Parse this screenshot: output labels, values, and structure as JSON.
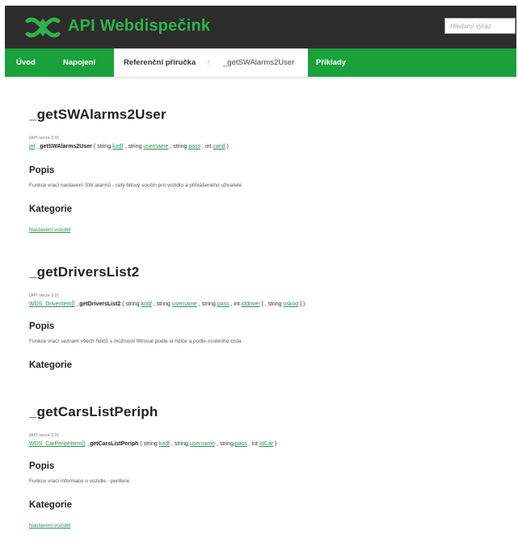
{
  "header": {
    "brand": "API Webdispečink",
    "search_placeholder": "Hledaný výraz",
    "colors": {
      "topbar": "#2c2c2c",
      "nav": "#1aa13c",
      "brand": "#2db34a",
      "link": "#2e8b57"
    }
  },
  "nav": {
    "uvod": "Úvod",
    "napojeni": "Napojení",
    "referencni": "Referenční příručka",
    "separator": "/",
    "current": "_getSWAlarms2User",
    "priklady": "Příklady"
  },
  "sections": [
    {
      "title": "_getSWAlarms2User",
      "api": "(API verze 2.0)",
      "return_type": "int",
      "fn": "_getSWAlarms2User",
      "p1_type": "string",
      "p1": "kodf",
      "p2_type": "string",
      "p2": "username",
      "p3_type": "string",
      "p3": "pass",
      "p4_type": "int",
      "p4": "carid",
      "popis_heading": "Popis",
      "popis": "Funkce vrací nastavení SW alarmů - celý bitový součin pro vozidlo a přihlášeného uživatele",
      "kategorie_heading": "Kategorie",
      "kategorie": "Nastavení vozidel"
    },
    {
      "title": "_getDriversList2",
      "api": "(API verze 2.0)",
      "return_type": "WDS_DriverItem[]",
      "fn": "_getDriversList2",
      "p1_type": "string",
      "p1": "kodf",
      "p2_type": "string",
      "p2": "username",
      "p3_type": "string",
      "p3": "pass",
      "p4_type": "int",
      "p4": "iddriver",
      "p5_type": "string",
      "p5": "oskod",
      "popis_heading": "Popis",
      "popis": "Funkce vrací seznam všech řidičů s možností filtrovat podle id řidiče a podle osobního čísla",
      "kategorie_heading": "Kategorie"
    },
    {
      "title": "_getCarsListPeriph",
      "api": "(API verze 2.0)",
      "return_type": "WDS_CarPeriphItem[]",
      "fn": "_getCarsListPeriph",
      "p1_type": "string",
      "p1": "kodf",
      "p2_type": "string",
      "p2": "username",
      "p3_type": "string",
      "p3": "pass",
      "p4_type": "int",
      "p4": "IdCar",
      "popis_heading": "Popis",
      "popis": "Funkce vrací informace o vozidle - periferie",
      "kategorie_heading": "Kategorie",
      "kategorie": "Nastavení vozidel"
    }
  ]
}
